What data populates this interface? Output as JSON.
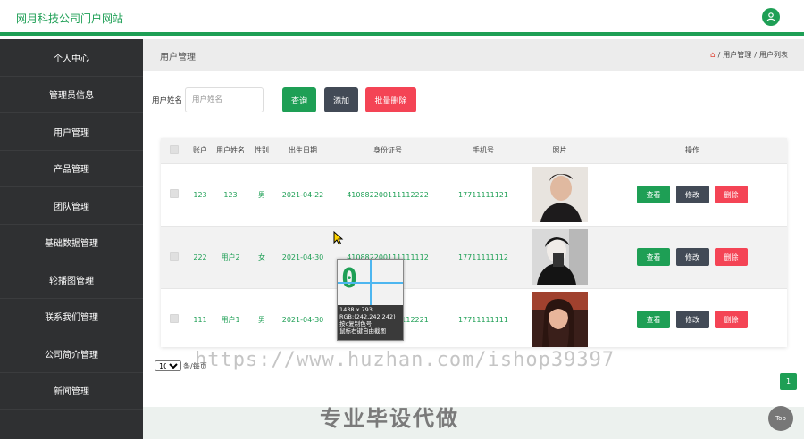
{
  "header": {
    "title": "网月科技公司门户网站",
    "user_icon": "user-icon"
  },
  "sidebar": {
    "items": [
      {
        "label": "个人中心"
      },
      {
        "label": "管理员信息"
      },
      {
        "label": "用户管理"
      },
      {
        "label": "产品管理"
      },
      {
        "label": "团队管理"
      },
      {
        "label": "基础数据管理"
      },
      {
        "label": "轮播图管理"
      },
      {
        "label": "联系我们管理"
      },
      {
        "label": "公司简介管理"
      },
      {
        "label": "新闻管理"
      }
    ]
  },
  "crumbbar": {
    "title": "用户管理",
    "crumbs": [
      "用户管理",
      "用户列表"
    ],
    "separator": "/"
  },
  "search": {
    "label": "用户姓名",
    "placeholder": "用户姓名",
    "query_btn": "查询",
    "add_btn": "添加",
    "batch_delete_btn": "批量删除"
  },
  "table": {
    "headers": [
      "账户",
      "用户姓名",
      "性别",
      "出生日期",
      "身份证号",
      "手机号",
      "照片",
      "操作"
    ],
    "rows": [
      {
        "account": "123",
        "name": "123",
        "gender": "男",
        "birth": "2021-04-22",
        "id_no": "410882200111112222",
        "phone": "17711111121"
      },
      {
        "account": "222",
        "name": "用户2",
        "gender": "女",
        "birth": "2021-04-30",
        "id_no": "410882200111111112",
        "phone": "17711111112"
      },
      {
        "account": "111",
        "name": "用户1",
        "gender": "男",
        "birth": "2021-04-30",
        "id_no": "410882200111112221",
        "phone": "17711111111"
      }
    ],
    "actions": {
      "view": "查看",
      "edit": "修改",
      "delete": "删除"
    }
  },
  "pagination": {
    "page_size": "10",
    "page_size_suffix": "条/每页",
    "current_page": "1"
  },
  "picker": {
    "zoom_glyph": "0",
    "size": "1438 x 793",
    "rgb": "RGB:(242,242,242)",
    "hint1": "按c复制色号",
    "hint2": "鼠标右键自由截图"
  },
  "watermark": "https://www.huzhan.com/ishop39397",
  "promo": "专业毕设代做",
  "top_button": "Top",
  "colors": {
    "accent": "#1e9f55",
    "sidebar_bg": "#2f3032",
    "danger": "#f44455",
    "dark_btn": "#424a56"
  }
}
